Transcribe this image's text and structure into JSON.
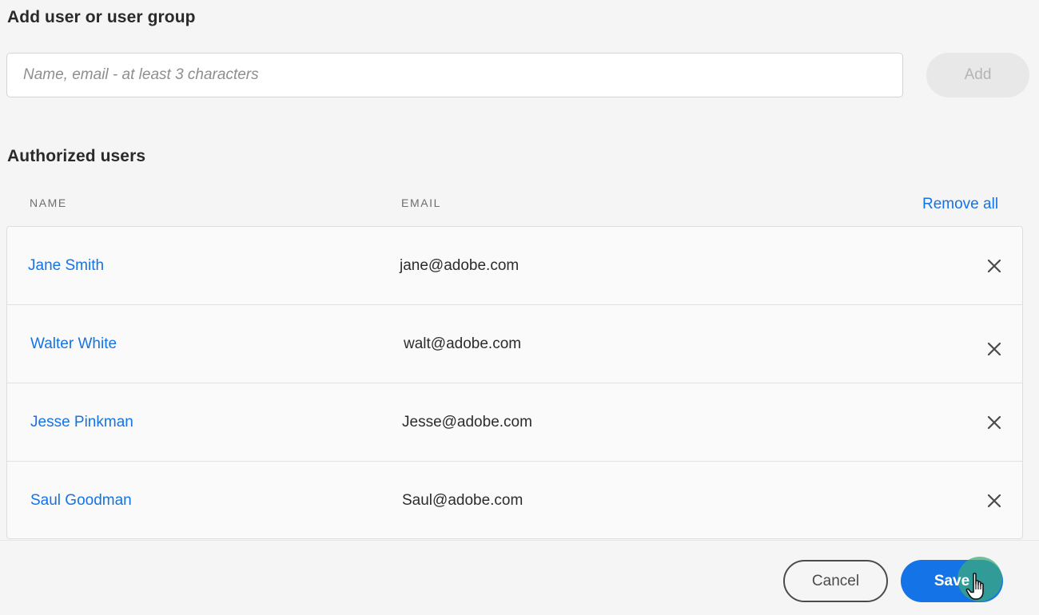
{
  "add_section": {
    "title": "Add user or user group",
    "search_placeholder": "Name, email - at least 3 characters",
    "search_value": "",
    "add_label": "Add"
  },
  "authorized_section": {
    "title": "Authorized users",
    "columns": [
      "NAME",
      "EMAIL"
    ],
    "remove_all_label": "Remove all",
    "users": [
      {
        "name": "Jane Smith",
        "email": "jane@adobe.com"
      },
      {
        "name": "Walter White",
        "email": "walt@adobe.com"
      },
      {
        "name": "Jesse Pinkman",
        "email": "Jesse@adobe.com"
      },
      {
        "name": "Saul Goodman",
        "email": "Saul@adobe.com"
      }
    ],
    "remove_icon": "close-icon"
  },
  "footer": {
    "cancel_label": "Cancel",
    "save_label": "Save"
  },
  "colors": {
    "accent": "#1473e6",
    "background": "#f5f5f5",
    "disabled_button": "#e8e8e8",
    "click_highlight": "#3caa78"
  }
}
